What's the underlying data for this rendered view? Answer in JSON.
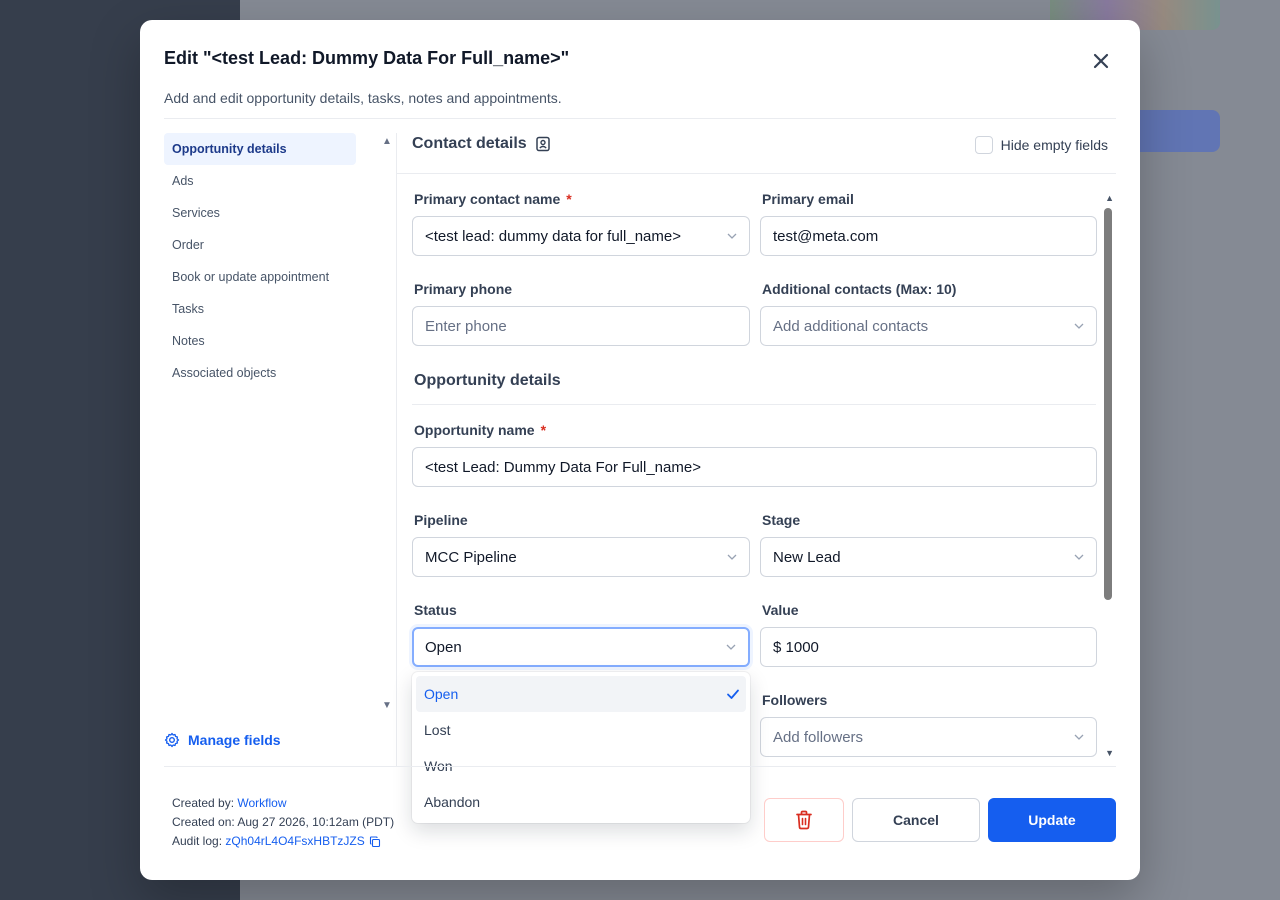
{
  "modal": {
    "title": "Edit \"<test Lead: Dummy Data For Full_name>\"",
    "subtitle": "Add and edit opportunity details, tasks, notes and appointments."
  },
  "nav": {
    "items": [
      {
        "label": "Opportunity details",
        "active": true
      },
      {
        "label": "Ads"
      },
      {
        "label": "Services"
      },
      {
        "label": "Order"
      },
      {
        "label": "Book or update appointment"
      },
      {
        "label": "Tasks"
      },
      {
        "label": "Notes"
      },
      {
        "label": "Associated objects"
      }
    ],
    "manage_fields": "Manage fields"
  },
  "contact": {
    "header": "Contact details",
    "hide_empty_label": "Hide empty fields",
    "primary_name_label": "Primary contact name",
    "primary_name_value": "<test lead: dummy data for full_name>",
    "primary_email_label": "Primary email",
    "primary_email_value": "test@meta.com",
    "primary_phone_label": "Primary phone",
    "primary_phone_placeholder": "Enter phone",
    "additional_label": "Additional contacts (Max: 10)",
    "additional_placeholder": "Add additional contacts"
  },
  "opportunity": {
    "header": "Opportunity details",
    "name_label": "Opportunity name",
    "name_value": "<test Lead: Dummy Data For Full_name>",
    "pipeline_label": "Pipeline",
    "pipeline_value": "MCC Pipeline",
    "stage_label": "Stage",
    "stage_value": "New Lead",
    "status_label": "Status",
    "status_value": "Open",
    "value_label": "Value",
    "value_value": "$ 1000",
    "followers_label": "Followers",
    "followers_placeholder": "Add followers"
  },
  "required_mark": "*",
  "status_dropdown": {
    "options": [
      "Open",
      "Lost",
      "Won",
      "Abandon"
    ],
    "selected": "Open"
  },
  "footer": {
    "created_by_label": "Created by:",
    "created_by_value": "Workflow",
    "created_on": "Created on: Aug 27 2026, 10:12am (PDT)",
    "audit_label": "Audit log:",
    "audit_value": "zQh04rL4O4FsxHBTzJZS",
    "cancel": "Cancel",
    "update": "Update"
  },
  "colors": {
    "primary": "#155eef",
    "danger": "#d92d20"
  }
}
